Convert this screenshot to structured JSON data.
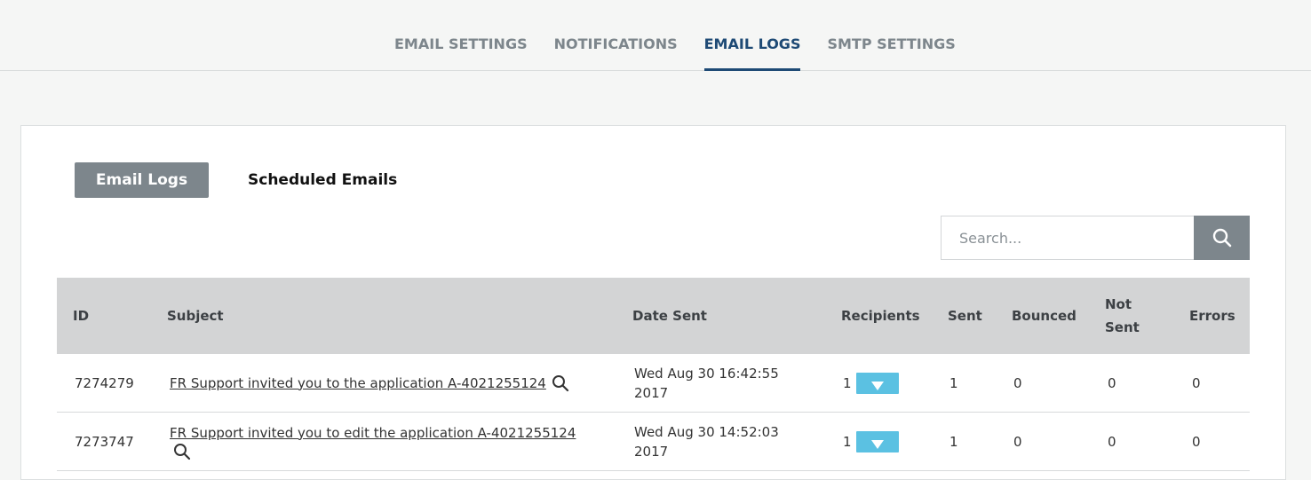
{
  "nav": {
    "tabs": [
      {
        "label": "EMAIL SETTINGS"
      },
      {
        "label": "NOTIFICATIONS"
      },
      {
        "label": "EMAIL LOGS"
      },
      {
        "label": "SMTP SETTINGS"
      }
    ],
    "active": "EMAIL LOGS"
  },
  "subtabs": {
    "email_logs": "Email Logs",
    "scheduled_emails": "Scheduled Emails"
  },
  "search": {
    "placeholder": "Search...",
    "button_icon": "search-icon"
  },
  "table": {
    "columns": {
      "id": "ID",
      "subject": "Subject",
      "date_sent": "Date Sent",
      "recipients": "Recipients",
      "sent": "Sent",
      "bounced": "Bounced",
      "not_sent_line1": "Not",
      "not_sent_line2": "Sent",
      "errors": "Errors"
    },
    "rows": [
      {
        "id": "7274279",
        "subject": "FR Support invited you to the application A-4021255124",
        "date_line1": "Wed Aug 30 16:42:55",
        "date_line2": "2017",
        "recipients": "1",
        "sent": "1",
        "bounced": "0",
        "not_sent": "0",
        "errors": "0"
      },
      {
        "id": "7273747",
        "subject": "FR Support invited you to edit the application A-4021255124",
        "date_line1": "Wed Aug 30 14:52:03",
        "date_line2": "2017",
        "recipients": "1",
        "sent": "1",
        "bounced": "0",
        "not_sent": "0",
        "errors": "0"
      }
    ]
  },
  "colors": {
    "accent": "#1e4a75",
    "button_gray": "#7d868c",
    "recipients_button": "#5bc1e2",
    "header_bg": "#d3d4d5"
  }
}
